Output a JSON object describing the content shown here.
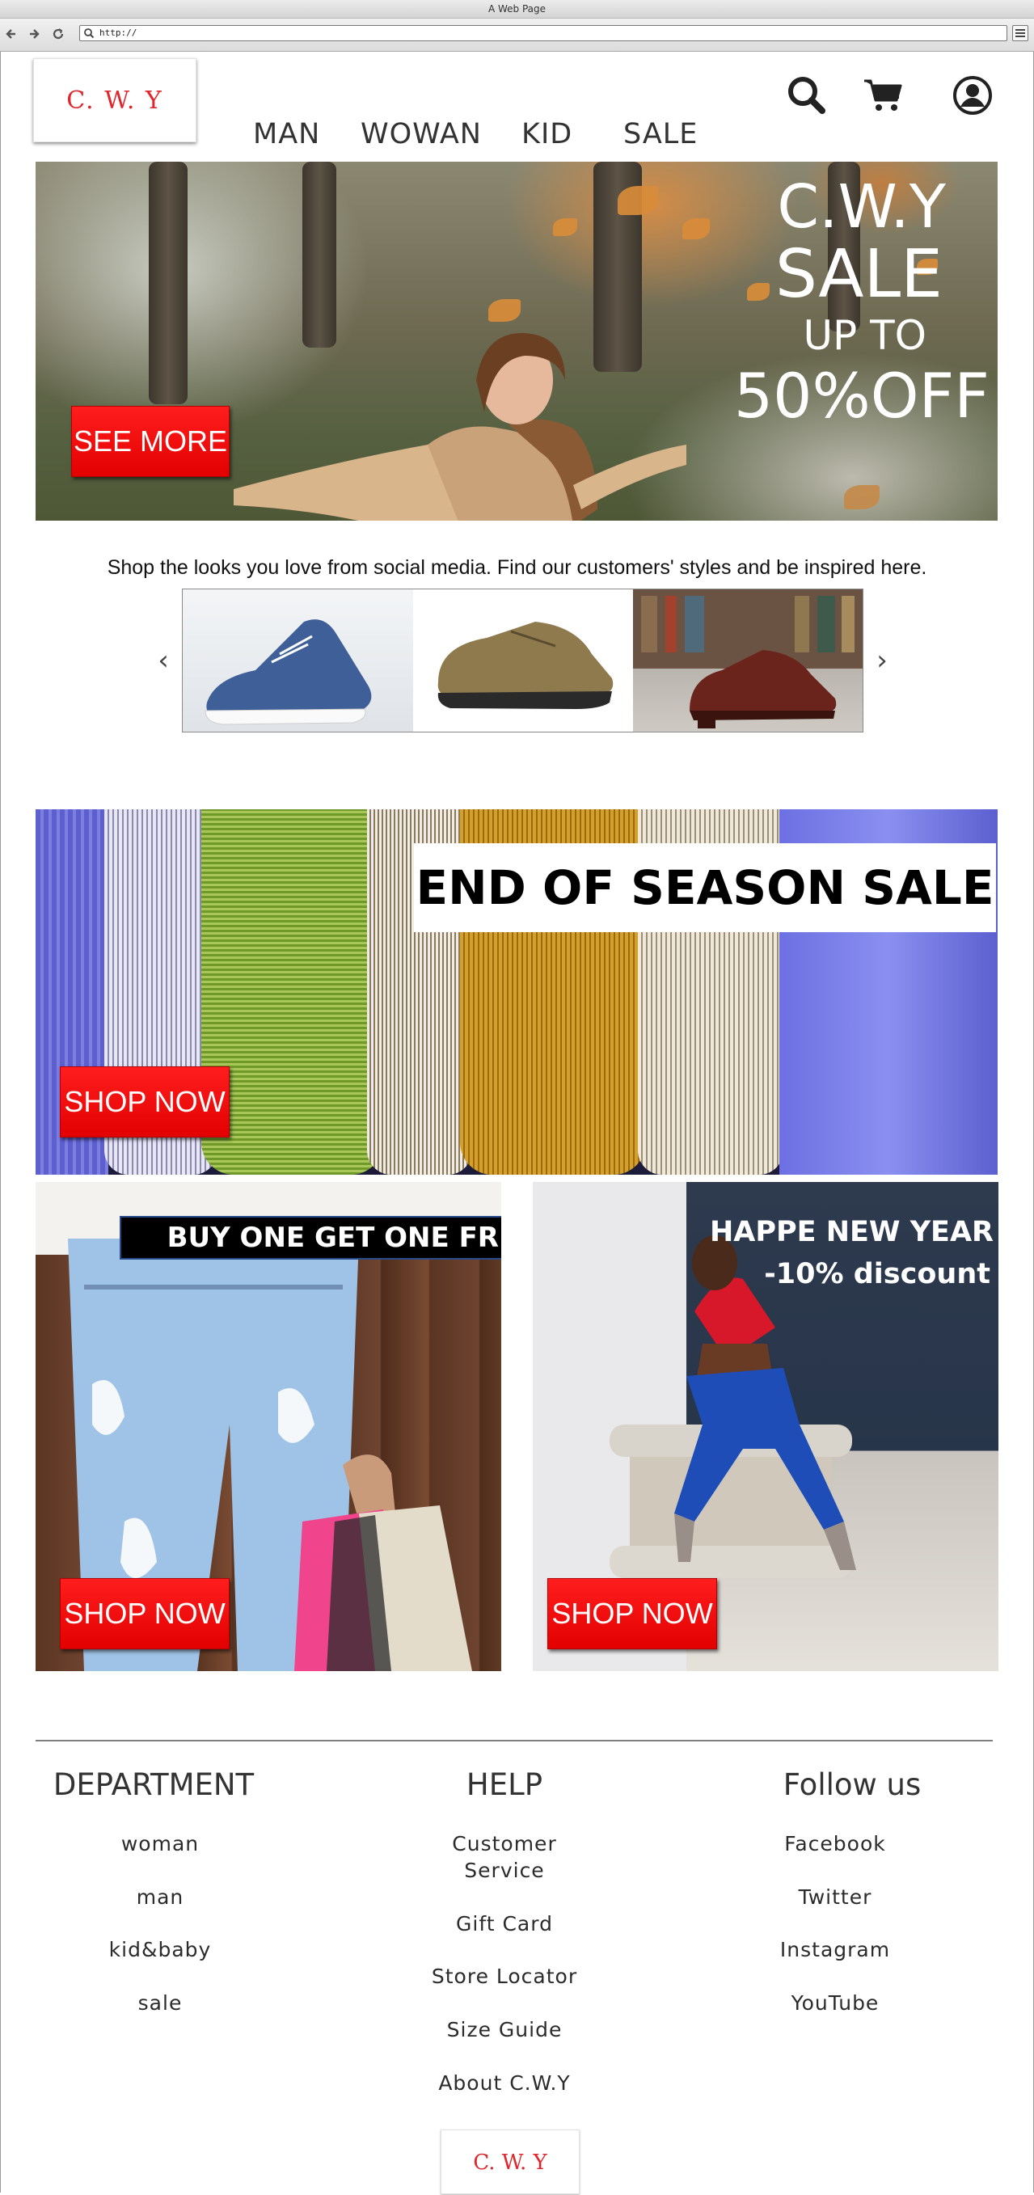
{
  "browser": {
    "title": "A Web Page",
    "url": "http://"
  },
  "header": {
    "logo": "C. W. Y",
    "nav": [
      "MAN",
      "WOWAN",
      "KID",
      "SALE"
    ],
    "icons": [
      "search-icon",
      "cart-icon",
      "account-icon"
    ]
  },
  "hero": {
    "line1": "C.W.Y",
    "line2": "SALE",
    "line3": "UP TO",
    "line4": "50%OFF",
    "cta": "SEE MORE"
  },
  "inspiration": {
    "tagline": "Shop the looks you love from social media. Find our customers' styles and be inspired here.",
    "prev": "‹",
    "next": "›",
    "items": [
      "blue canvas sneaker",
      "olive suede shoe",
      "brown leather oxford"
    ]
  },
  "season_banner": {
    "title": "END OF SEASON SALE",
    "cta": "SHOP NOW"
  },
  "promo_left": {
    "title": "BUY ONE GET ONE FREE",
    "cta": "SHOP NOW"
  },
  "promo_right": {
    "line1": "HAPPE NEW YEAR",
    "line2": "-10% discount",
    "cta": "SHOP NOW"
  },
  "footer": {
    "department": {
      "heading": "DEPARTMENT",
      "links": [
        "woman",
        "man",
        "kid&baby",
        "sale"
      ]
    },
    "help": {
      "heading": "HELP",
      "links": [
        "Customer",
        "Service",
        "Gift Card",
        "Store Locator",
        "Size Guide",
        "About C.W.Y"
      ]
    },
    "follow": {
      "heading": "Follow us",
      "links": [
        "Facebook",
        "Twitter",
        "Instagram",
        "YouTube"
      ]
    },
    "logo": "C. W. Y"
  },
  "colors": {
    "brand_red": "#e0262c",
    "button_red": "#ff1a1a",
    "text_dark": "#333333"
  }
}
